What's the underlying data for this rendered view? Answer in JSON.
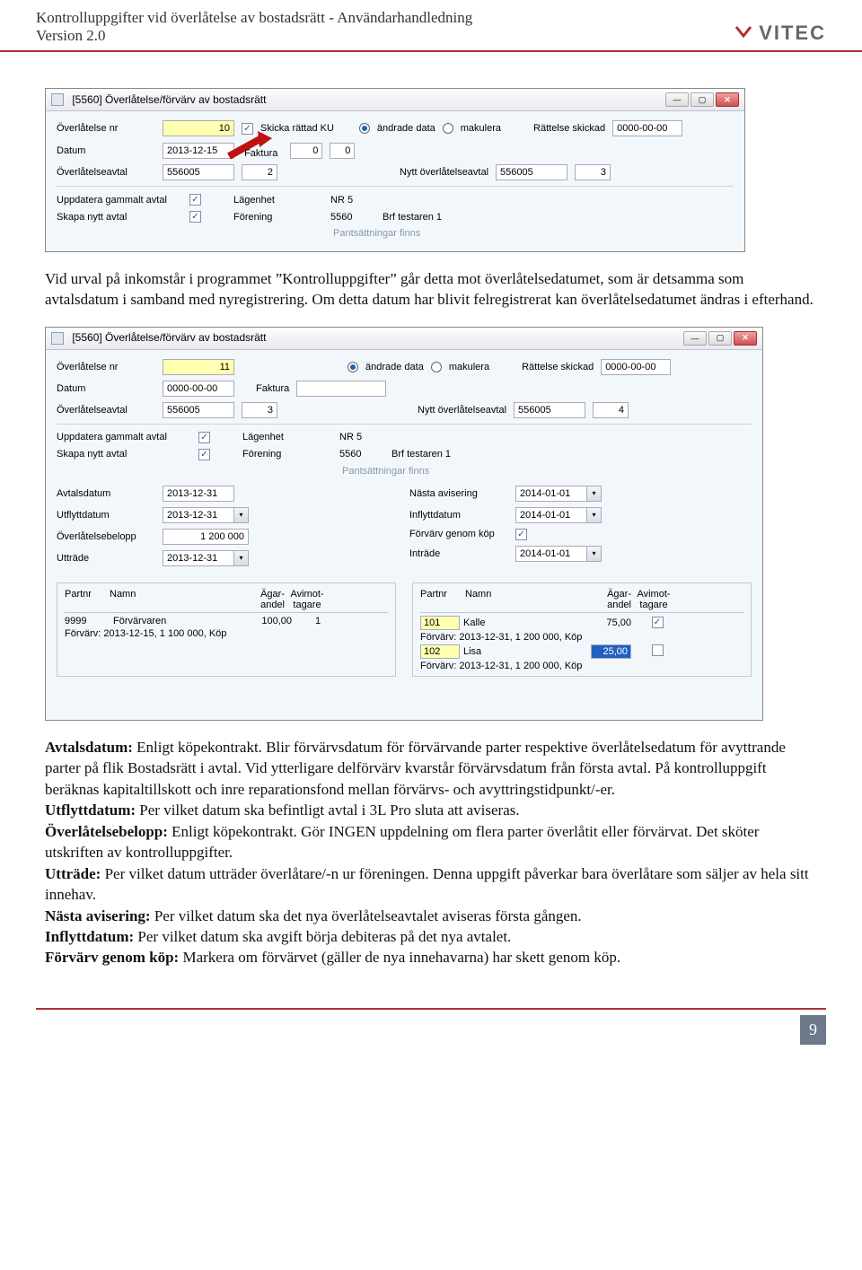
{
  "header": {
    "title": "Kontrolluppgifter vid överlåtelse av bostadsrätt - Användarhandledning",
    "version": "Version 2.0",
    "logo_text": "VITEC"
  },
  "shot1": {
    "window_title": "[5560] Överlåtelse/förvärv av bostadsrätt",
    "labels": {
      "overlatelse_nr": "Överlåtelse nr",
      "skicka_rattad": "Skicka rättad KU",
      "andrade_data": "ändrade data",
      "makulera": "makulera",
      "rattelse_skickad": "Rättelse skickad",
      "datum": "Datum",
      "faktura": "Faktura",
      "overlatelseavtal": "Överlåtelseavtal",
      "nytt_avtal": "Nytt överlåtelseavtal",
      "uppdatera": "Uppdatera gammalt avtal",
      "skapa": "Skapa nytt avtal",
      "lagenhet": "Lägenhet",
      "forening": "Förening",
      "brf": "Brf testaren 1",
      "pant": "Pantsättningar finns"
    },
    "values": {
      "overlatelse_nr": "10",
      "rattelse_skickad": "0000-00-00",
      "datum": "2013-12-15",
      "faktura1": "0",
      "faktura2": "0",
      "overlatelseavtal": "556005",
      "overlatelseavtal2": "2",
      "nytt_avtal": "556005",
      "nytt_avtal2": "3",
      "lagenhet": "NR 5",
      "forening": "5560"
    }
  },
  "para1": "Vid urval på inkomstår i programmet ”Kontrolluppgifter” går detta mot överlåtelsedatumet, som är detsamma som avtalsdatum i samband med nyregistrering. Om detta datum har blivit felregistrerat kan överlåtelsedatumet ändras i efterhand.",
  "shot2": {
    "window_title": "[5560] Överlåtelse/förvärv av bostadsrätt",
    "labels": {
      "overlatelse_nr": "Överlåtelse nr",
      "andrade_data": "ändrade data",
      "makulera": "makulera",
      "rattelse_skickad": "Rättelse skickad",
      "datum": "Datum",
      "faktura": "Faktura",
      "overlatelseavtal": "Överlåtelseavtal",
      "nytt_avtal": "Nytt överlåtelseavtal",
      "uppdatera": "Uppdatera gammalt avtal",
      "skapa": "Skapa nytt avtal",
      "lagenhet": "Lägenhet",
      "forening": "Förening",
      "brf": "Brf testaren 1",
      "pant": "Pantsättningar finns",
      "avtalsdatum": "Avtalsdatum",
      "utflyttdatum": "Utflyttdatum",
      "overlatelsebelopp": "Överlåtelsebelopp",
      "uttrade": "Utträde",
      "nasta_avisering": "Nästa avisering",
      "inflyttdatum": "Inflyttdatum",
      "forvarv_kop": "Förvärv genom köp",
      "intrade": "Inträde",
      "partnr": "Partnr",
      "namn": "Namn",
      "agarandel": "Ägar-\nandel",
      "avimottagare": "Avimot-\ntagare"
    },
    "values": {
      "overlatelse_nr": "11",
      "rattelse_skickad": "0000-00-00",
      "datum": "0000-00-00",
      "overlatelseavtal": "556005",
      "overlatelseavtal2": "3",
      "nytt_avtal": "556005",
      "nytt_avtal2": "4",
      "lagenhet": "NR 5",
      "forening": "5560",
      "avtalsdatum": "2013-12-31",
      "utflyttdatum": "2013-12-31",
      "overlatelsebelopp": "1 200 000",
      "uttrade": "2013-12-31",
      "nasta_avisering": "2014-01-01",
      "inflyttdatum": "2014-01-01",
      "intrade": "2014-01-01"
    },
    "left_table": {
      "row": {
        "partnr": "9999",
        "namn": "Förvärvaren",
        "andel": "100,00",
        "tag": "1"
      },
      "detail": "Förvärv: 2013-12-15, 1 100 000, Köp"
    },
    "right_table": {
      "rows": [
        {
          "partnr": "101",
          "namn": "Kalle",
          "andel": "75,00",
          "checked": true,
          "detail": "Förvärv: 2013-12-31, 1 200 000, Köp"
        },
        {
          "partnr": "102",
          "namn": "Lisa",
          "andel": "25,00",
          "checked": false,
          "detail": "Förvärv: 2013-12-31, 1 200 000, Köp"
        }
      ]
    }
  },
  "para2": {
    "t1b": "Avtalsdatum:",
    "t1": " Enligt köpekontrakt. Blir förvärvsdatum för förvärvande parter respektive överlåtelsedatum för avyttrande parter på flik Bostadsrätt i avtal. Vid ytterligare delförvärv kvarstår förvärvsdatum från första avtal. På kontrolluppgift beräknas kapitaltillskott och inre reparationsfond mellan förvärvs- och avyttringstidpunkt/-er.",
    "t2b": "Utflyttdatum:",
    "t2": " Per vilket datum ska befintligt avtal i 3L Pro sluta att aviseras.",
    "t3b": "Överlåtelsebelopp:",
    "t3": " Enligt köpekontrakt. Gör INGEN uppdelning om flera parter överlåtit eller förvärvat. Det sköter utskriften av kontrolluppgifter.",
    "t4b": "Utträde:",
    "t4": " Per vilket datum utträder överlåtare/-n ur föreningen. Denna uppgift påverkar bara överlåtare som säljer av hela sitt innehav.",
    "t5b": "Nästa avisering:",
    "t5": " Per vilket datum ska det nya överlåtelseavtalet aviseras första gången.",
    "t6b": "Inflyttdatum:",
    "t6": " Per vilket datum ska avgift börja debiteras på det nya avtalet.",
    "t7b": "Förvärv genom köp:",
    "t7": " Markera om förvärvet (gäller de nya innehavarna) har skett genom köp."
  },
  "page_number": "9"
}
